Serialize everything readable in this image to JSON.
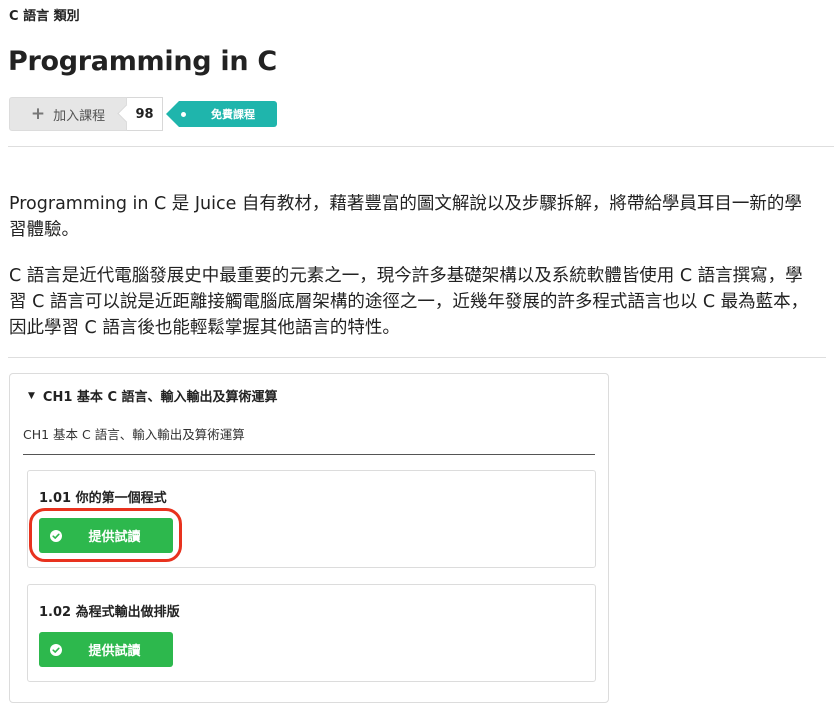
{
  "breadcrumb": "C 語言 類別",
  "page_title": "Programming in C",
  "actions": {
    "add_course_label": "加入課程",
    "course_count": "98",
    "free_tag": "免費課程"
  },
  "description": [
    "Programming in C 是 Juice 自有教材，藉著豐富的圖文解說以及步驟拆解，將帶給學員耳目一新的學習體驗。",
    "C 語言是近代電腦發展史中最重要的元素之一，現今許多基礎架構以及系統軟體皆使用 C 語言撰寫，學習 C 語言可以說是近距離接觸電腦底層架構的途徑之一，近幾年發展的許多程式語言也以 C 最為藍本，因此學習 C 語言後也能輕鬆掌握其他語言的特性。"
  ],
  "chapter": {
    "title": "CH1 基本 C 語言、輸入輸出及算術運算",
    "subtitle": "CH1 基本 C 語言、輸入輸出及算術運算",
    "lessons": [
      {
        "title": "1.01 你的第一個程式",
        "button": "提供試讀"
      },
      {
        "title": "1.02 為程式輸出做排版",
        "button": "提供試讀"
      }
    ]
  },
  "colors": {
    "tag": "#1fb5ac",
    "trial_button": "#2db84d",
    "highlight_ring": "#e8321e"
  }
}
